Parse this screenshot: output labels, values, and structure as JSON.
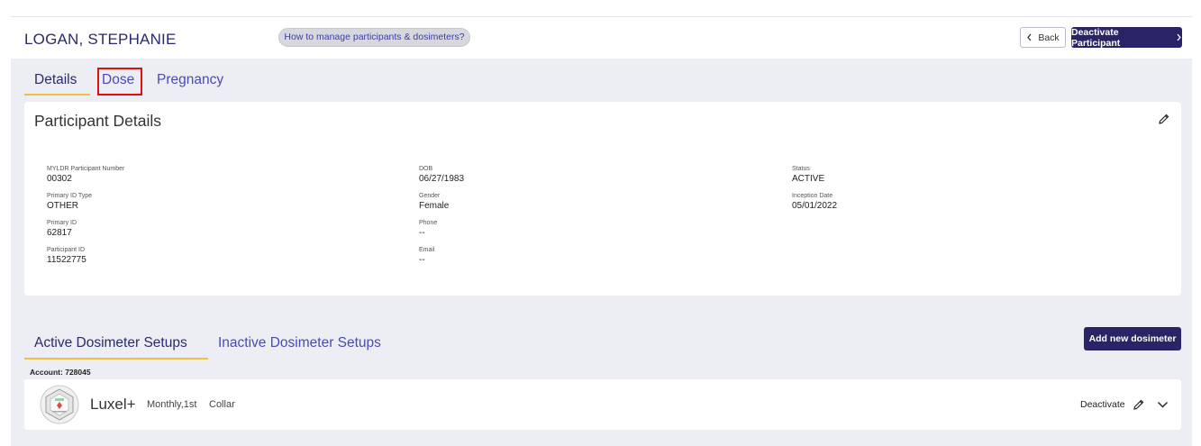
{
  "participant": {
    "name": "LOGAN, STEPHANIE"
  },
  "help": {
    "label": "How to manage participants & dosimeters?"
  },
  "actions": {
    "back_label": "Back",
    "deactivate_label": "Deactivate Participant"
  },
  "tabs": [
    {
      "label": "Details"
    },
    {
      "label": "Dose"
    },
    {
      "label": "Pregnancy"
    }
  ],
  "details_card": {
    "title": "Participant Details",
    "fields": {
      "mpn_label": "MYLDR Participant Number",
      "mpn_value": "00302",
      "pidtype_label": "Primary ID Type",
      "pidtype_value": "OTHER",
      "pid_label": "Primary ID",
      "pid_value": "62817",
      "partid_label": "Participant ID",
      "partid_value": "11522775",
      "dob_label": "DOB",
      "dob_value": "06/27/1983",
      "gender_label": "Gender",
      "gender_value": "Female",
      "phone_label": "Phone",
      "phone_value": "--",
      "email_label": "Email",
      "email_value": "--",
      "status_label": "Status",
      "status_value": "ACTIVE",
      "inception_label": "Inception Date",
      "inception_value": "05/01/2022"
    }
  },
  "dosimeter_tabs": [
    {
      "label": "Active Dosimeter Setups"
    },
    {
      "label": "Inactive Dosimeter Setups"
    }
  ],
  "add_dosimeter_label": "Add new dosimeter",
  "account_label": "Account: 728045",
  "dosimeters": [
    {
      "product": "Luxel+",
      "frequency": "Monthly,1st",
      "location": "Collar",
      "action": "Deactivate"
    }
  ],
  "colors": {
    "brand_dark": "#282466",
    "tab_underline": "#f0c040",
    "highlight_box": "#e01010",
    "background": "#eceef3"
  }
}
